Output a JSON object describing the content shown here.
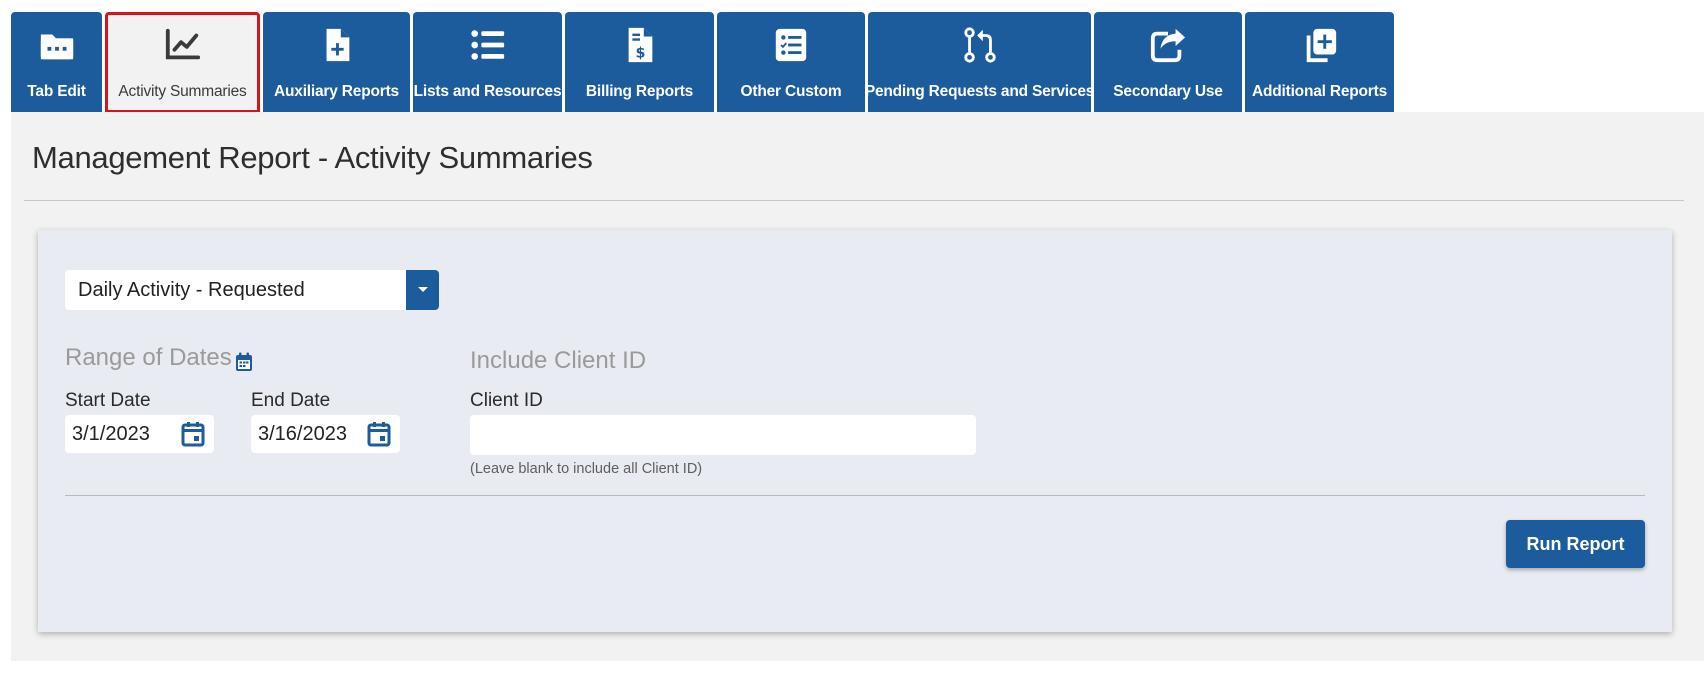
{
  "tabs": [
    {
      "label": "Tab Edit",
      "icon": "folder-icon",
      "active": false
    },
    {
      "label": "Activity Summaries",
      "icon": "line-chart-icon",
      "active": true
    },
    {
      "label": "Auxiliary Reports",
      "icon": "file-plus-icon",
      "active": false
    },
    {
      "label": "Lists and Resources",
      "icon": "list-icon",
      "active": false
    },
    {
      "label": "Billing Reports",
      "icon": "file-invoice-dollar-icon",
      "active": false
    },
    {
      "label": "Other Custom",
      "icon": "checklist-icon",
      "active": false
    },
    {
      "label": "Pending Requests and Services",
      "icon": "code-pull-request-icon",
      "active": false
    },
    {
      "label": "Secondary Use",
      "icon": "share-square-icon",
      "active": false
    },
    {
      "label": "Additional Reports",
      "icon": "copy-plus-icon",
      "active": false
    }
  ],
  "page": {
    "title": "Management Report - Activity Summaries"
  },
  "report_select": {
    "value": "Daily Activity - Requested"
  },
  "date_range": {
    "heading": "Range of Dates",
    "start_label": "Start Date",
    "start_value": "3/1/2023",
    "end_label": "End Date",
    "end_value": "3/16/2023"
  },
  "client": {
    "heading": "Include Client ID",
    "label": "Client ID",
    "value": "",
    "hint": "(Leave blank to include all Client ID)"
  },
  "actions": {
    "run_label": "Run Report"
  },
  "colors": {
    "primary": "#1c5b9c",
    "active_tab_outline": "#d7141c",
    "page_bg": "#f2f2f2",
    "panel_bg": "#e9ebf3"
  }
}
